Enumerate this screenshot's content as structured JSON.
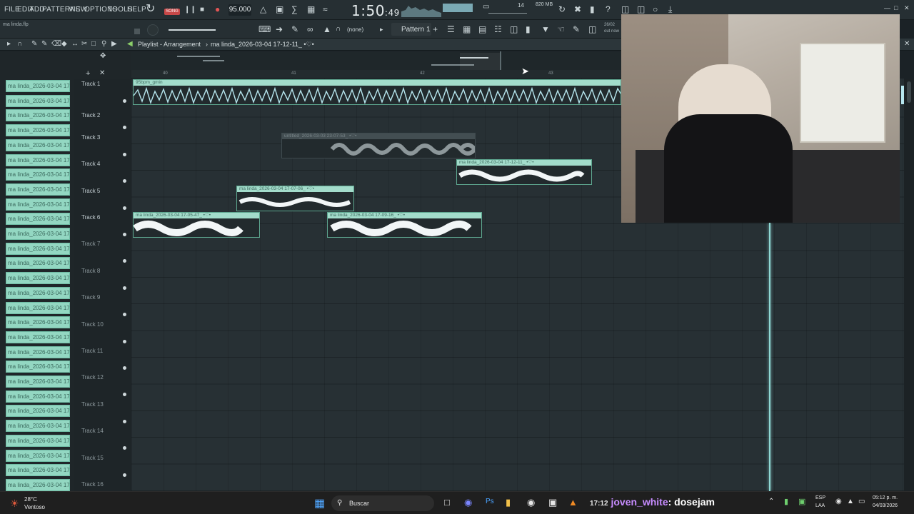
{
  "menu": [
    "FILE",
    "EDIT",
    "ADD",
    "PATTERNS",
    "VIEW",
    "OPTIONS",
    "TOOLS",
    "HELP"
  ],
  "transport": {
    "mode": "SONG",
    "tempo": "95.000",
    "time": "1:50",
    "time_small": ":49",
    "memory": "820 MB",
    "cpu": "14"
  },
  "project": {
    "filename": "ma linda.flp",
    "pattern": "Pattern 1",
    "snap": "(none)",
    "hint_date": "26/02",
    "hint_text": "out now"
  },
  "playlist": {
    "title": "Playlist - Arrangement",
    "breadcrumb": "ma linda_2026-03-04 17-12-11_ •♡•",
    "ruler": [
      "40",
      "41",
      "42",
      "43"
    ],
    "tracks": [
      "Track 1",
      "Track 2",
      "Track 3",
      "Track 4",
      "Track 5",
      "Track 6",
      "Track 7",
      "Track 8",
      "Track 9",
      "Track 10",
      "Track 11",
      "Track 12",
      "Track 13",
      "Track 14",
      "Track 15",
      "Track 16"
    ],
    "clips": {
      "c1": "95bpm_gmin",
      "c2": "untitled_2026-03-03 23-07-53_ •♡•",
      "c3": "ma linda_2026-03-04 17-12-11_ •♡•",
      "c4": "ma linda_2026-03-04 17-07-06_ •♡•",
      "c5": "ma linda_2026-03-04 17-05-47_ •♡•",
      "c6": "ma linda_2026-03-04 17-09-16_ •♡•"
    }
  },
  "browser": {
    "item_label": "ma linda_2026-03-04 17-"
  },
  "taskbar": {
    "weather_temp": "28°C",
    "weather_desc": "Ventoso",
    "search": "Buscar",
    "chat_time": "17:12",
    "chat_user": "joven_white",
    "chat_msg": ": dosejam",
    "lang": "ESP",
    "lang2": "LAA",
    "clock_time": "05:12 p. m.",
    "clock_date": "04/03/2026"
  },
  "colors": {
    "clip": "#a3dccb",
    "playhead": "#8fd8d4",
    "background": "#273034"
  }
}
